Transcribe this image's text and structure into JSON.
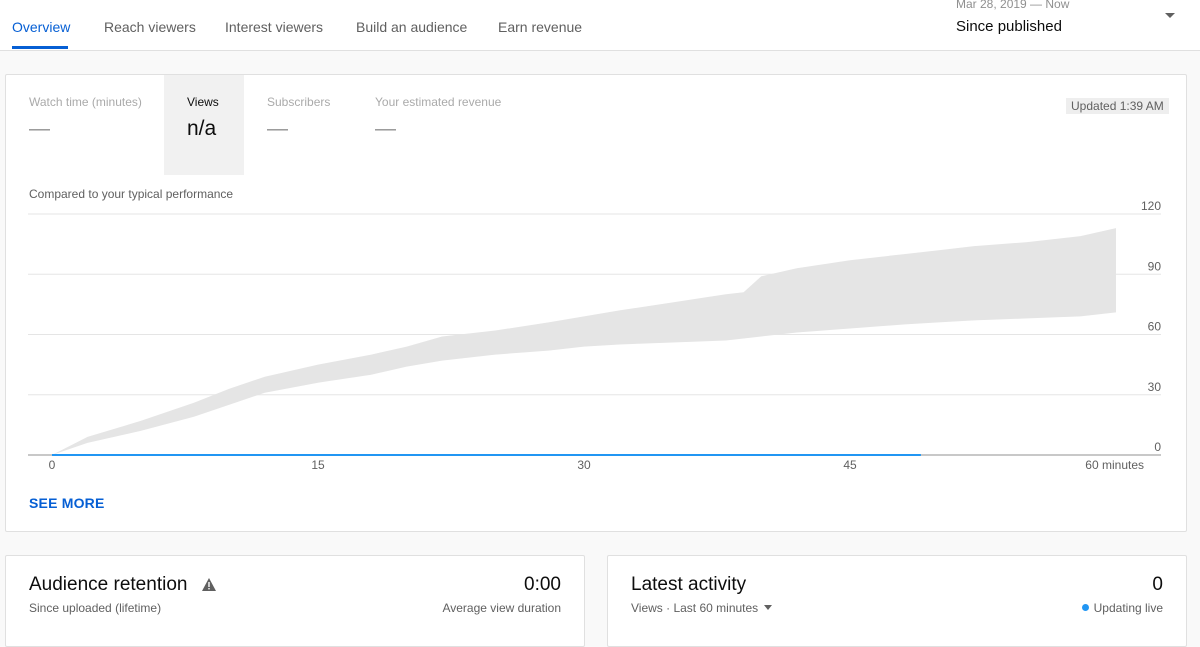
{
  "tabs": [
    {
      "label": "Overview",
      "active": true
    },
    {
      "label": "Reach viewers",
      "active": false
    },
    {
      "label": "Interest viewers",
      "active": false
    },
    {
      "label": "Build an audience",
      "active": false
    },
    {
      "label": "Earn revenue",
      "active": false
    }
  ],
  "date_range": {
    "label": "Mar 28, 2019 — Now",
    "value": "Since published"
  },
  "metrics": [
    {
      "label": "Watch time (minutes)",
      "value": "—",
      "selected": false
    },
    {
      "label": "Views",
      "value": "n/a",
      "selected": true
    },
    {
      "label": "Subscribers",
      "value": "—",
      "selected": false
    },
    {
      "label": "Your estimated revenue",
      "value": "—",
      "selected": false
    }
  ],
  "updated": "Updated 1:39 AM",
  "compared_label": "Compared to your typical performance",
  "see_more": "SEE MORE",
  "colors": {
    "accent": "#065fd4",
    "band": "#e5e5e5",
    "line": "#2196f3",
    "live_dot": "#2196f3"
  },
  "chart_data": {
    "type": "area",
    "x_tick_labels": [
      "0",
      "15",
      "30",
      "45",
      "60 minutes"
    ],
    "y_tick_labels": [
      "0",
      "30",
      "60",
      "90",
      "120"
    ],
    "xlim": [
      0,
      60
    ],
    "ylim": [
      0,
      120
    ],
    "grid": true,
    "typical_band": {
      "x": [
        0,
        2,
        5,
        8,
        10,
        12,
        15,
        18,
        20,
        22,
        25,
        28,
        30,
        32,
        35,
        38,
        39,
        40,
        42,
        45,
        48,
        50,
        52,
        55,
        58,
        60
      ],
      "lower": [
        0,
        6,
        12,
        19,
        25,
        31,
        36,
        40,
        44,
        47,
        50,
        52,
        54,
        55,
        56,
        57,
        58,
        59,
        61,
        63,
        65,
        66,
        67,
        68,
        69,
        71
      ],
      "upper": [
        0,
        9,
        17,
        26,
        33,
        39,
        45,
        50,
        54,
        59,
        62,
        66,
        69,
        72,
        76,
        80,
        81,
        89,
        93,
        97,
        100,
        102,
        104,
        106,
        109,
        113
      ]
    },
    "series": [
      {
        "x": [
          0,
          49
        ],
        "values": [
          0,
          0
        ]
      }
    ]
  },
  "retention": {
    "title": "Audience retention",
    "subtitle": "Since uploaded (lifetime)",
    "value": "0:00",
    "value_label": "Average view duration"
  },
  "activity": {
    "title": "Latest activity",
    "subtitle": "Views · Last 60 minutes",
    "value": "0",
    "status": "Updating live"
  }
}
